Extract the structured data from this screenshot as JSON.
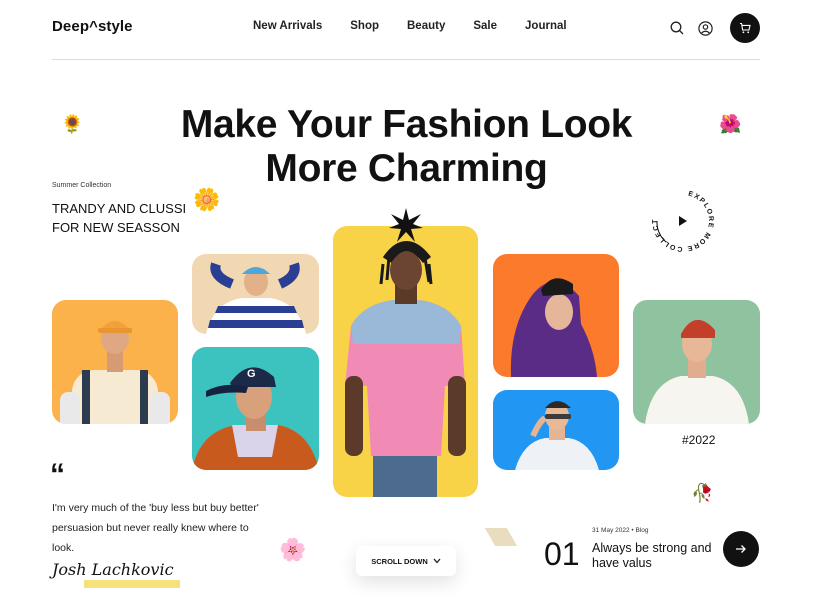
{
  "header": {
    "logo": "Deep^style",
    "nav": [
      "New Arrivals",
      "Shop",
      "Beauty",
      "Sale",
      "Journal"
    ],
    "icons": [
      "search-icon",
      "user-icon",
      "cart-icon"
    ]
  },
  "hero": {
    "title_line1": "Make Your Fashion Look",
    "title_line2": "More Charming",
    "eyebrow": "Summer Collection",
    "tagline": "TRANDY AND CLUSSI FOR NEW SEASSON"
  },
  "explore": {
    "text": "EXPLORE MORE COLLECTION"
  },
  "year_tag": "#2022",
  "quote": {
    "mark": "“",
    "text": "I'm very much of the 'buy less but buy better' persuasion but never really knew where to look.",
    "signature": "Josh Lachkovic"
  },
  "scroll": {
    "label": "SCROLL DOWN"
  },
  "blog": {
    "number": "01",
    "date": "31 May 2022",
    "category": "Blog",
    "title": "Always be strong and have valus"
  },
  "colors": {
    "card_orange": "#fbb24a",
    "card_beige": "#f1d8b3",
    "card_teal": "#3cc3c0",
    "card_yellow": "#f8d348",
    "card_orange2": "#fb7a2b",
    "card_blue": "#2196f3",
    "card_green": "#8fc3a0"
  }
}
